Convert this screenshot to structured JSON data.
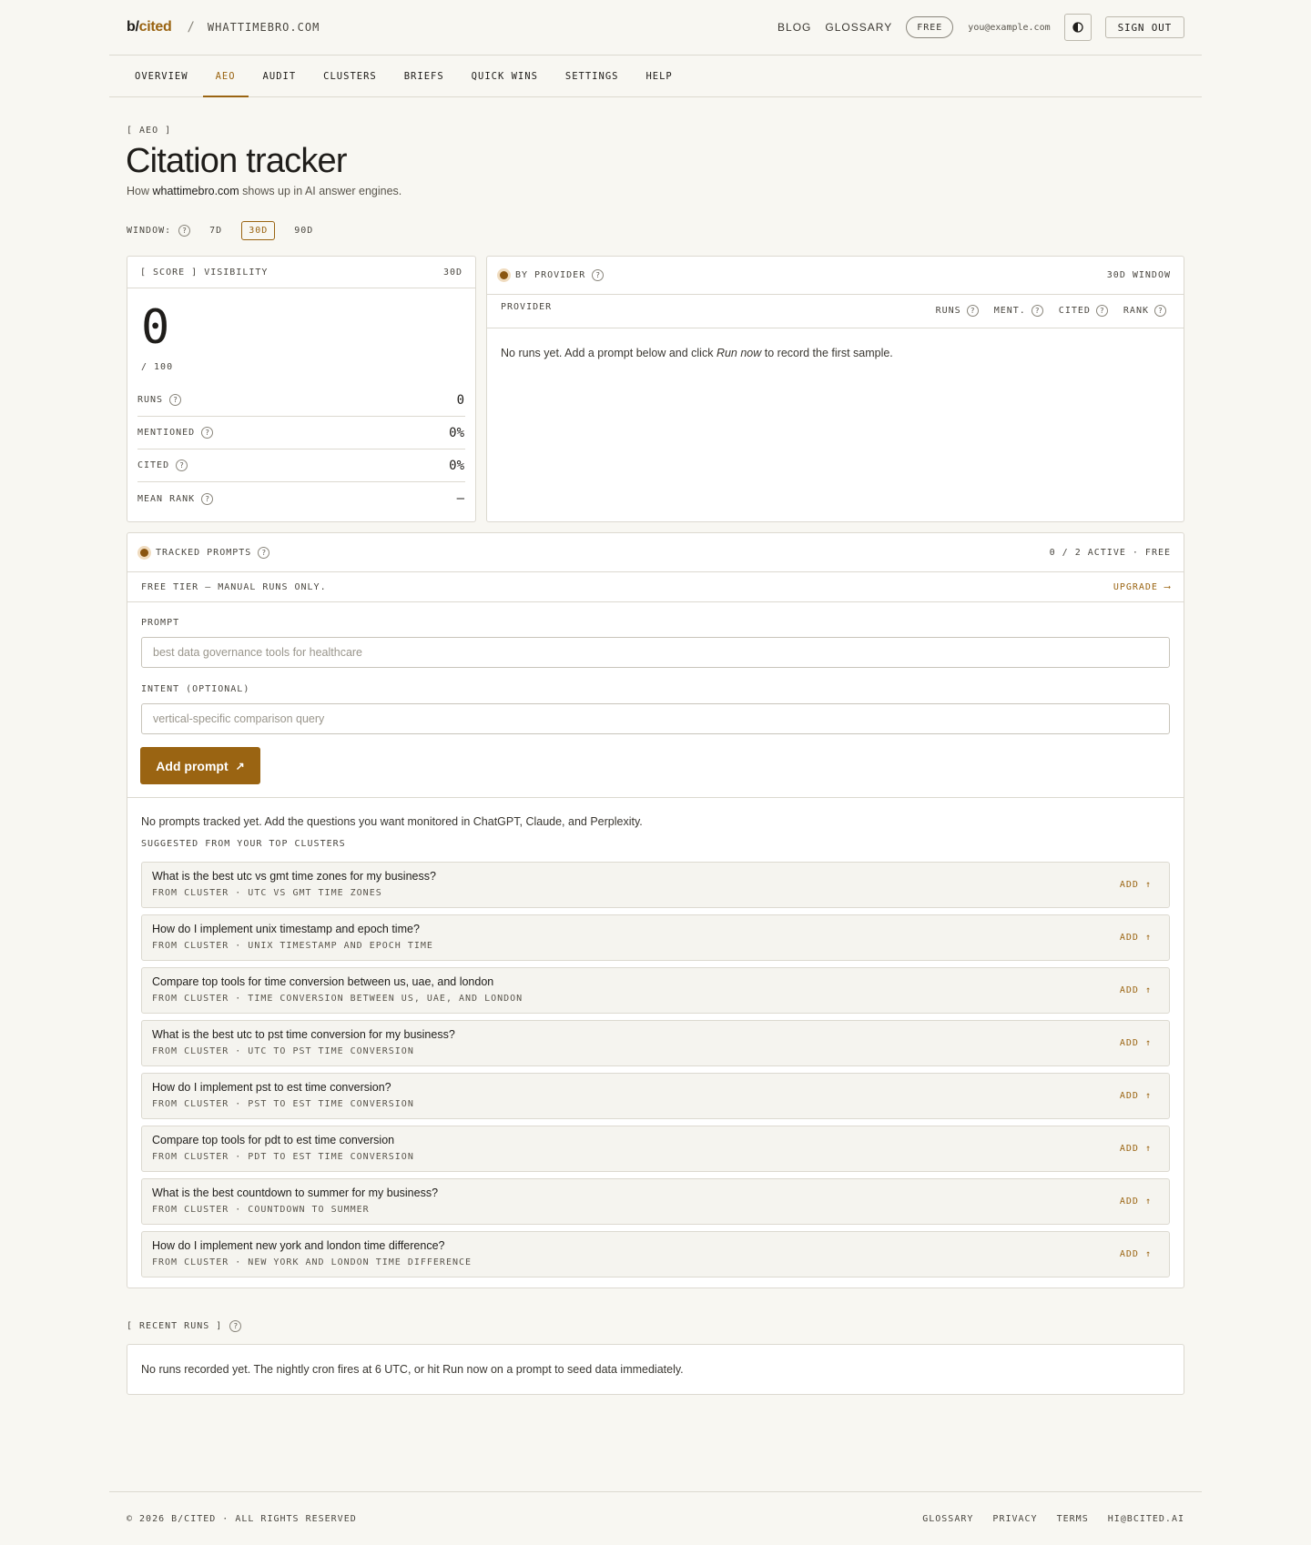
{
  "header": {
    "logo_prefix": "b/",
    "logo_suffix": "cited",
    "separator": "/",
    "domain": "WHATTIMEBRO.COM",
    "links": [
      "BLOG",
      "GLOSSARY"
    ],
    "plan_badge": "FREE",
    "email": "you@example.com",
    "sign_out": "SIGN OUT"
  },
  "nav": {
    "tabs": [
      "OVERVIEW",
      "AEO",
      "AUDIT",
      "CLUSTERS",
      "BRIEFS",
      "QUICK WINS",
      "SETTINGS",
      "HELP"
    ],
    "active": "AEO"
  },
  "page": {
    "eyebrow": "[ AEO ]",
    "title": "Citation tracker",
    "subtitle_pre": "How ",
    "subtitle_domain": "whattimebro.com",
    "subtitle_post": " shows up in AI answer engines."
  },
  "window": {
    "label": "WINDOW:",
    "options": [
      "7D",
      "30D",
      "90D"
    ],
    "selected": "30D"
  },
  "score": {
    "header": "[ SCORE ] VISIBILITY",
    "window": "30D",
    "value": "0",
    "out_of": "/ 100",
    "stats": [
      {
        "label": "RUNS",
        "value": "0"
      },
      {
        "label": "MENTIONED",
        "value": "0%"
      },
      {
        "label": "CITED",
        "value": "0%"
      },
      {
        "label": "MEAN RANK",
        "value": "—"
      }
    ]
  },
  "provider": {
    "header": "BY PROVIDER",
    "window": "30D WINDOW",
    "col_provider": "PROVIDER",
    "columns": [
      "RUNS",
      "MENT.",
      "CITED",
      "RANK"
    ],
    "empty_pre": "No runs yet. Add a prompt below and click ",
    "empty_em": "Run now",
    "empty_post": " to record the first sample."
  },
  "tracked": {
    "header": "TRACKED PROMPTS",
    "status": "0 / 2 ACTIVE · FREE",
    "tier_note": "FREE TIER — MANUAL RUNS ONLY.",
    "upgrade": "UPGRADE ⟶",
    "prompt_label": "PROMPT",
    "prompt_placeholder": "best data governance tools for healthcare",
    "intent_label": "INTENT (OPTIONAL)",
    "intent_placeholder": "vertical-specific comparison query",
    "add_button": "Add prompt",
    "add_arrow": "↗",
    "empty": "No prompts tracked yet. Add the questions you want monitored in ChatGPT, Claude, and Perplexity.",
    "suggest_label": "SUGGESTED FROM YOUR TOP CLUSTERS",
    "add_label": "ADD ↑",
    "suggestions": [
      {
        "q": "What is the best utc vs gmt time zones for my business?",
        "cluster": "FROM CLUSTER · UTC VS GMT TIME ZONES"
      },
      {
        "q": "How do I implement unix timestamp and epoch time?",
        "cluster": "FROM CLUSTER · UNIX TIMESTAMP AND EPOCH TIME"
      },
      {
        "q": "Compare top tools for time conversion between us, uae, and london",
        "cluster": "FROM CLUSTER · TIME CONVERSION BETWEEN US, UAE, AND LONDON"
      },
      {
        "q": "What is the best utc to pst time conversion for my business?",
        "cluster": "FROM CLUSTER · UTC TO PST TIME CONVERSION"
      },
      {
        "q": "How do I implement pst to est time conversion?",
        "cluster": "FROM CLUSTER · PST TO EST TIME CONVERSION"
      },
      {
        "q": "Compare top tools for pdt to est time conversion",
        "cluster": "FROM CLUSTER · PDT TO EST TIME CONVERSION"
      },
      {
        "q": "What is the best countdown to summer for my business?",
        "cluster": "FROM CLUSTER · COUNTDOWN TO SUMMER"
      },
      {
        "q": "How do I implement new york and london time difference?",
        "cluster": "FROM CLUSTER · NEW YORK AND LONDON TIME DIFFERENCE"
      }
    ]
  },
  "recent": {
    "header": "[ RECENT RUNS ]",
    "empty": "No runs recorded yet. The nightly cron fires at 6 UTC, or hit Run now on a prompt to seed data immediately."
  },
  "footer": {
    "copyright": "© 2026 B/CITED · ALL RIGHTS RESERVED",
    "links": [
      "GLOSSARY",
      "PRIVACY",
      "TERMS",
      "HI@BCITED.AI"
    ]
  },
  "colors": {
    "accent": "#9a6412",
    "background": "#f8f7f2",
    "border": "#dcd9d0"
  },
  "icons": {
    "help": "question-circle-icon",
    "theme": "half-circle-contrast-icon",
    "status": "dot-icon"
  }
}
